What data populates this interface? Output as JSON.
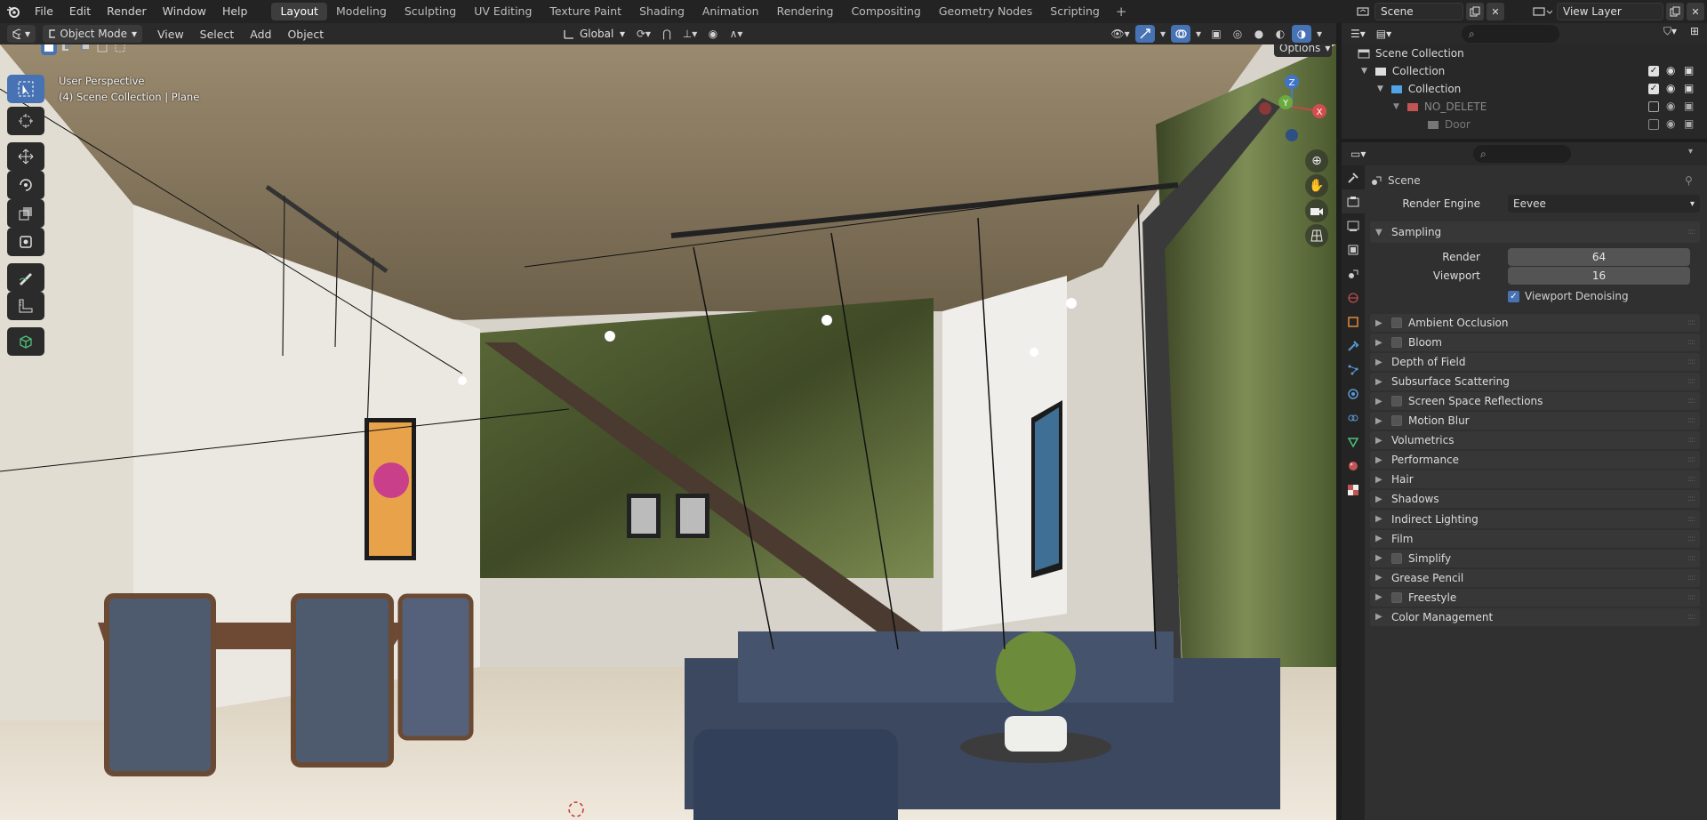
{
  "topbar": {
    "menus": [
      "File",
      "Edit",
      "Render",
      "Window",
      "Help"
    ],
    "workspaces": [
      "Layout",
      "Modeling",
      "Sculpting",
      "UV Editing",
      "Texture Paint",
      "Shading",
      "Animation",
      "Rendering",
      "Compositing",
      "Geometry Nodes",
      "Scripting"
    ],
    "active_workspace": "Layout",
    "scene_name": "Scene",
    "view_layer_name": "View Layer"
  },
  "viewport_header": {
    "mode": "Object Mode",
    "menus": [
      "View",
      "Select",
      "Add",
      "Object"
    ],
    "transform_orientation": "Global",
    "options_label": "Options"
  },
  "viewport": {
    "view_name": "User Perspective",
    "context": "(4) Scene Collection | Plane",
    "gizmo": {
      "x": "X",
      "y": "Y",
      "z": "Z"
    }
  },
  "outliner": {
    "root": "Scene Collection",
    "rows": [
      {
        "label": "Collection",
        "indent": 1
      },
      {
        "label": "Collection",
        "indent": 2
      },
      {
        "label": "NO_DELETE",
        "indent": 3
      },
      {
        "label": "Door",
        "indent": 4
      }
    ]
  },
  "properties": {
    "context_title": "Scene",
    "render_engine_label": "Render Engine",
    "render_engine": "Eevee",
    "sampling": {
      "title": "Sampling",
      "render_label": "Render",
      "render_value": "64",
      "viewport_label": "Viewport",
      "viewport_value": "16",
      "denoise_label": "Viewport Denoising",
      "denoise_checked": true
    },
    "panels": [
      {
        "label": "Ambient Occlusion",
        "checkbox": true
      },
      {
        "label": "Bloom",
        "checkbox": true
      },
      {
        "label": "Depth of Field",
        "checkbox": false
      },
      {
        "label": "Subsurface Scattering",
        "checkbox": false
      },
      {
        "label": "Screen Space Reflections",
        "checkbox": true
      },
      {
        "label": "Motion Blur",
        "checkbox": true
      },
      {
        "label": "Volumetrics",
        "checkbox": false
      },
      {
        "label": "Performance",
        "checkbox": false
      },
      {
        "label": "Hair",
        "checkbox": false
      },
      {
        "label": "Shadows",
        "checkbox": false
      },
      {
        "label": "Indirect Lighting",
        "checkbox": false
      },
      {
        "label": "Film",
        "checkbox": false
      },
      {
        "label": "Simplify",
        "checkbox": true
      },
      {
        "label": "Grease Pencil",
        "checkbox": false
      },
      {
        "label": "Freestyle",
        "checkbox": true
      },
      {
        "label": "Color Management",
        "checkbox": false
      }
    ]
  },
  "colors": {
    "accent": "#4772b3",
    "background": "#1d1d1d",
    "panel": "#303030"
  }
}
